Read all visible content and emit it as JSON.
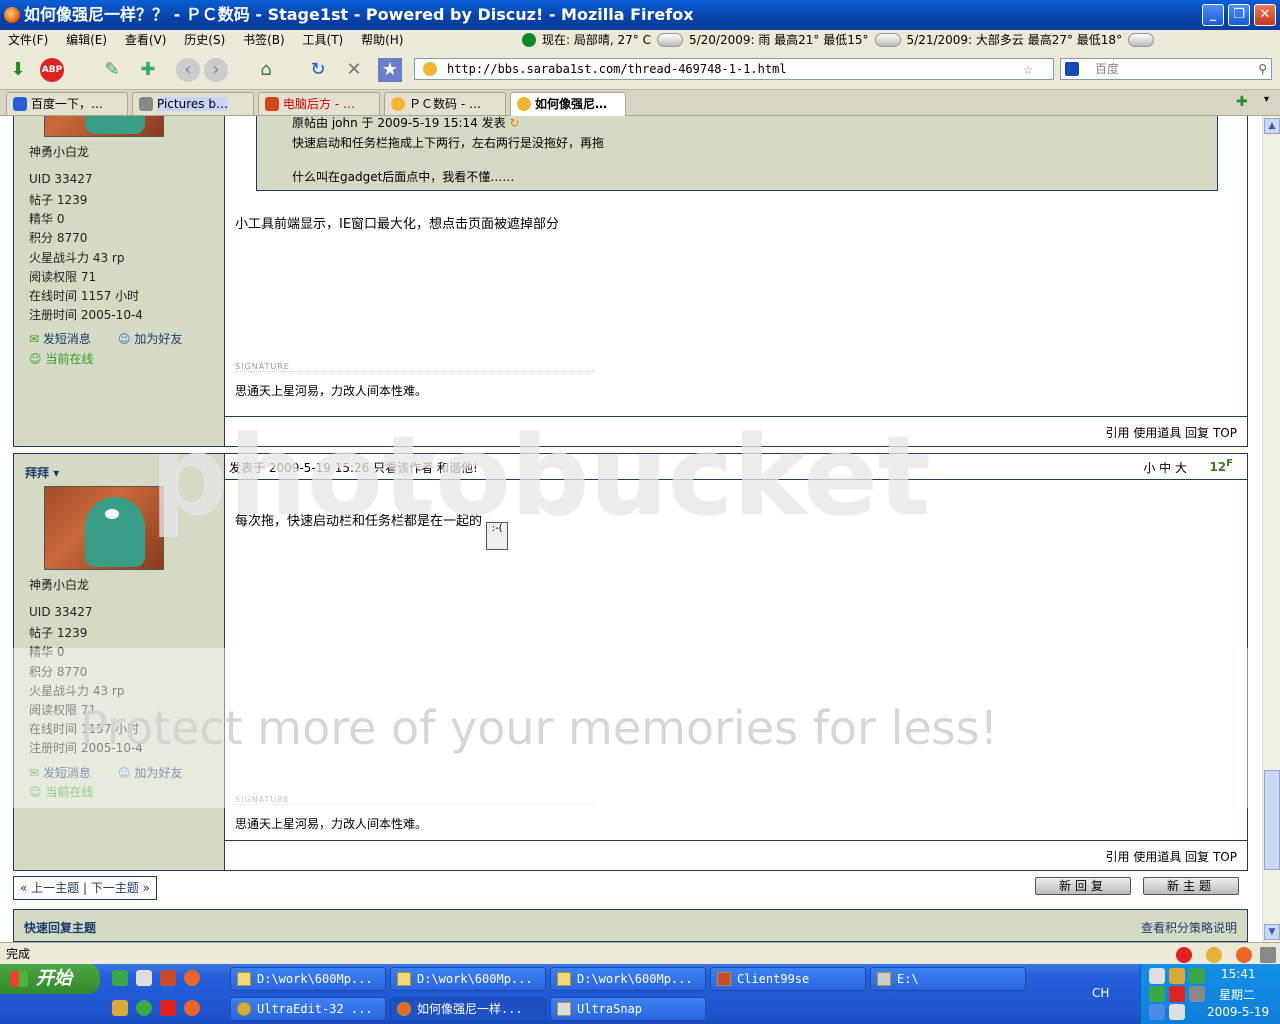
{
  "window": {
    "title": "如何像强尼一样？？ - ＰＣ数码 - Stage1st - Powered by Discuz! - Mozilla Firefox"
  },
  "menu": [
    "文件(F)",
    "编辑(E)",
    "查看(V)",
    "历史(S)",
    "书签(B)",
    "工具(T)",
    "帮助(H)"
  ],
  "weather": {
    "now": "现在: 局部晴, 27°  C",
    "day1": "5/20/2009: 雨  最高21°  最低15°",
    "day2": "5/21/2009: 大部多云  最高27°  最低18°"
  },
  "nav": {
    "url": "http://bbs.saraba1st.com/thread-469748-1-1.html",
    "search_placeholder": "百度"
  },
  "tabs": [
    {
      "label": "百度一下，…",
      "active": false
    },
    {
      "label": "Pictures b…",
      "active": false
    },
    {
      "label": "电脑后方 - …",
      "active": false
    },
    {
      "label": "ＰＣ数码 - …",
      "active": false
    },
    {
      "label": "如何像强尼…",
      "active": true
    }
  ],
  "post1": {
    "author_title": "神勇小白龙",
    "stats": [
      "UID  33427",
      "帖子  1239",
      "精华  0",
      "积分  8770",
      "火星战斗力  43 rp",
      "阅读权限  71",
      "在线时间  1157 小时",
      "注册时间  2005-10-4"
    ],
    "send_msg": "发短消息",
    "add_friend": "加为好友",
    "online": "当前在线",
    "quote_line": "原帖由 john 于 2009-5-19 15:14 发表",
    "quote_text": "快速启动和任务栏拖成上下两行，左右两行是没拖好，再拖",
    "quote_reply": "什么叫在gadget后面点中，我看不懂……",
    "body": "小工具前端显示，IE窗口最大化，想点击页面被遮掉部分",
    "sig_label": "SIGNATURE",
    "signature": "思通天上星河易，力改人间本性难。",
    "ops": "引用  使用道具  回复  TOP"
  },
  "post2": {
    "author": "拜拜",
    "header": "发表于 2009-5-19 15:26  只看该作者  和谐他!",
    "font_sizes": "小  中  大",
    "floor": "12",
    "floor_sup": "F",
    "author_title": "神勇小白龙",
    "stats": [
      "UID  33427",
      "帖子  1239",
      "精华  0",
      "积分  8770",
      "火星战斗力  43 rp",
      "阅读权限  71",
      "在线时间  1157 小时",
      "注册时间  2005-10-4"
    ],
    "send_msg": "发短消息",
    "add_friend": "加为好友",
    "online": "当前在线",
    "body": "每次拖，快速启动栏和任务栏都是在一起的",
    "sig_label": "SIGNATURE",
    "signature": "思通天上星河易，力改人间本性难。",
    "ops": "引用  使用道具  回复  TOP"
  },
  "footer": {
    "prevnext": "« 上一主题 | 下一主题 »",
    "new_reply": "新回复",
    "new_topic": "新主题",
    "quick_reply": "快速回复主题",
    "credit_help": "查看积分策略说明"
  },
  "watermark": {
    "logo": "photobucket",
    "banner": "Protect more of your memories for less!"
  },
  "status": {
    "text": "完成"
  },
  "taskbar": {
    "start": "开始",
    "row1": [
      "D:\\work\\600Mp...",
      "D:\\work\\600Mp...",
      "D:\\work\\600Mp...",
      "Client99se",
      "E:\\"
    ],
    "row2": [
      "UltraEdit-32 ...",
      "如何像强尼一样...",
      "UltraSnap"
    ],
    "lang": "CH",
    "time": "15:41",
    "weekday": "星期二",
    "date": "2009-5-19"
  }
}
